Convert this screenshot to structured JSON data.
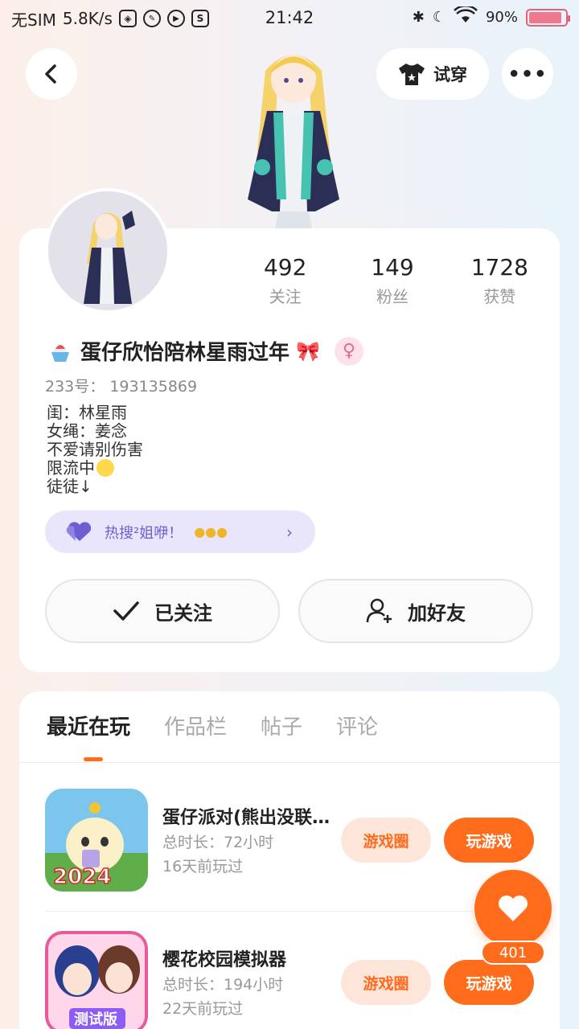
{
  "status_bar": {
    "carrier": "无SIM",
    "net_speed": "5.8K/s",
    "time": "21:42",
    "battery_percent": "90",
    "battery_level": 0.9
  },
  "header": {
    "tryon_label": "试穿"
  },
  "profile": {
    "stats": [
      {
        "value": "492",
        "label": "关注"
      },
      {
        "value": "149",
        "label": "粉丝"
      },
      {
        "value": "1728",
        "label": "获赞"
      }
    ],
    "name": "蛋仔欣怡陪林星雨过年",
    "id_label": "233号：",
    "id_value": "193135869",
    "bio": [
      "闺：林星雨",
      "女绳：姜念",
      "不爱请别伤害",
      "限流中",
      "徒徒↓"
    ],
    "hot_banner": "热搜²姐咿！"
  },
  "actions": {
    "followed_label": "已关注",
    "add_friend_label": "加好友"
  },
  "tabs": [
    {
      "label": "最近在玩",
      "active": true
    },
    {
      "label": "作品栏",
      "active": false
    },
    {
      "label": "帖子",
      "active": false
    },
    {
      "label": "评论",
      "active": false
    }
  ],
  "games": [
    {
      "title": "蛋仔派对(熊出没联动)",
      "duration_label": "总时长：72小时",
      "last_played": "16天前玩过",
      "icon_badge": "2024",
      "circle_label": "游戏圈",
      "play_label": "玩游戏"
    },
    {
      "title": "樱花校园模拟器",
      "duration_label": "总时长：194小时",
      "last_played": "22天前玩过",
      "icon_badge": "测试版",
      "circle_label": "游戏圈",
      "play_label": "玩游戏"
    }
  ],
  "like": {
    "count": "401"
  },
  "colors": {
    "accent": "#ff6d1c",
    "banner_text": "#6d5fd3",
    "gender": "#e86a8e"
  }
}
